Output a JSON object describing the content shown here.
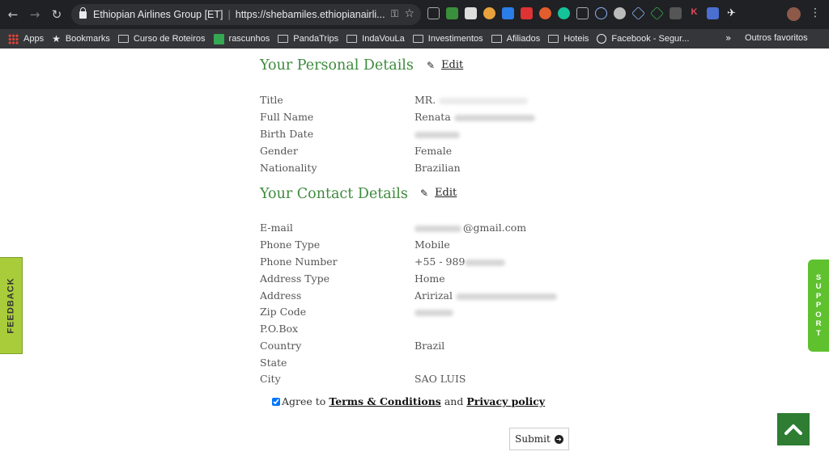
{
  "browser": {
    "tab_title": "Ethiopian Airlines Group [ET]",
    "url": "https://shebamiles.ethiopianairli...",
    "bookmarks": [
      {
        "label": "Apps",
        "icon": "apps-icon"
      },
      {
        "label": "Bookmarks",
        "icon": "star-icon"
      },
      {
        "label": "Curso de Roteiros",
        "icon": "folder-icon"
      },
      {
        "label": "rascunhos",
        "icon": "plus-icon"
      },
      {
        "label": "PandaTrips",
        "icon": "folder-icon"
      },
      {
        "label": "IndaVouLa",
        "icon": "folder-icon"
      },
      {
        "label": "Investimentos",
        "icon": "folder-icon"
      },
      {
        "label": "Afiliados",
        "icon": "folder-icon"
      },
      {
        "label": "Hoteis",
        "icon": "folder-icon"
      },
      {
        "label": "Facebook - Segur...",
        "icon": "globe-icon"
      }
    ],
    "overflow_label": "»",
    "other_bookmarks": "Outros favoritos"
  },
  "personal": {
    "title": "Your Personal Details",
    "edit_label": "Edit",
    "fields": [
      {
        "label": "Title",
        "value": "MR."
      },
      {
        "label": "Full Name",
        "value": "Renata"
      },
      {
        "label": "Birth Date",
        "value": ""
      },
      {
        "label": "Gender",
        "value": "Female"
      },
      {
        "label": "Nationality",
        "value": "Brazilian"
      }
    ]
  },
  "contact": {
    "title": "Your Contact Details",
    "edit_label": "Edit",
    "fields": [
      {
        "label": "E-mail",
        "value": "@gmail.com"
      },
      {
        "label": "Phone Type",
        "value": "Mobile"
      },
      {
        "label": "Phone Number",
        "value": "+55 - 989"
      },
      {
        "label": "Address Type",
        "value": "Home"
      },
      {
        "label": "Address",
        "value": "Aririzal"
      },
      {
        "label": "Zip Code",
        "value": ""
      },
      {
        "label": "P.O.Box",
        "value": ""
      },
      {
        "label": "Country",
        "value": "Brazil"
      },
      {
        "label": "State",
        "value": ""
      },
      {
        "label": "City",
        "value": "SAO LUIS"
      }
    ]
  },
  "agreement": {
    "checked": true,
    "prefix": "Agree to",
    "terms_label": "Terms & Conditions",
    "and_label": "and",
    "privacy_label": "Privacy policy"
  },
  "submit_label": "Submit",
  "feedback_label": "FEEDBACK",
  "support_letters": [
    "S",
    "U",
    "P",
    "P",
    "O",
    "R",
    "T"
  ],
  "colors": {
    "section_title": "#3d8a3d",
    "feedback_tab": "#a9cc3a",
    "support_tab": "#5fc12e",
    "scroll_top": "#2e7d32"
  }
}
